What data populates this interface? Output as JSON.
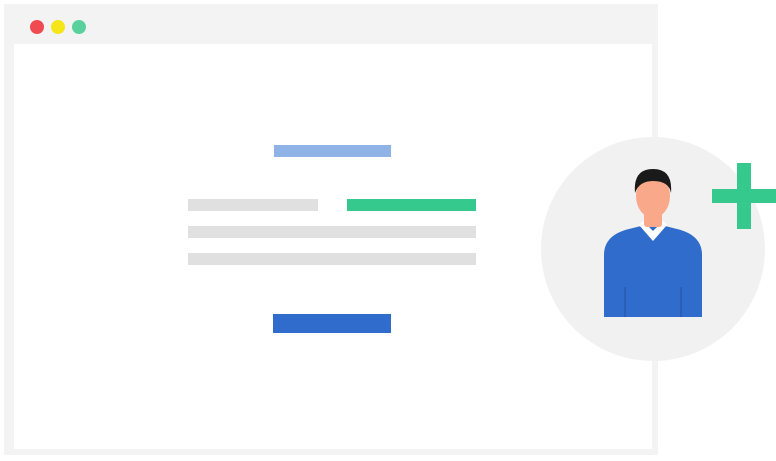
{
  "window": {
    "dots": [
      {
        "name": "close",
        "color": "#ef4b50"
      },
      {
        "name": "minimize",
        "color": "#f5e61a"
      },
      {
        "name": "maximize",
        "color": "#5ad19d"
      }
    ]
  },
  "form": {
    "heading_color": "#8fb3e6",
    "accent_color": "#35c98e",
    "line_color": "#e0e0e0",
    "button_color": "#2f6ccc"
  },
  "avatar": {
    "icon": "user-avatar-icon",
    "shirt_color": "#2f6ccc",
    "skin_color": "#f9a98a",
    "hair_color": "#1a1a1a",
    "badge_icon": "plus-icon",
    "badge_color": "#35c98e"
  }
}
